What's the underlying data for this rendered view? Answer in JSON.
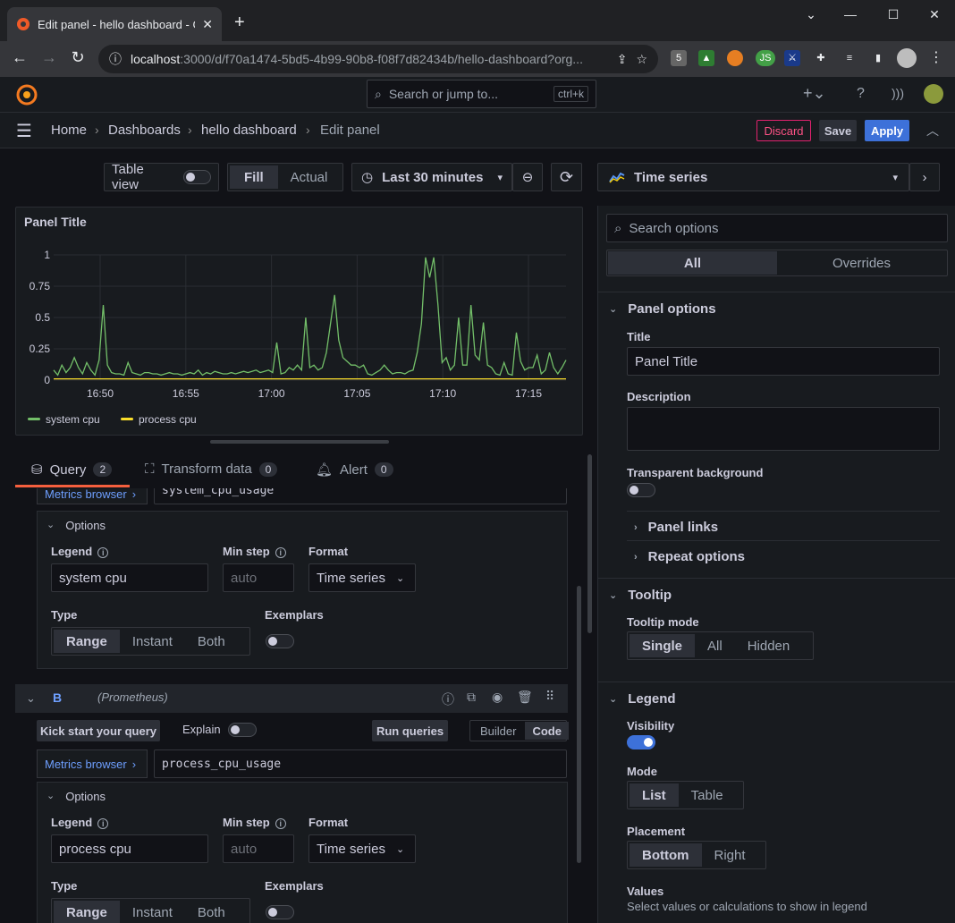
{
  "browser": {
    "tab_title": "Edit panel - hello dashboard - G",
    "url_host": "localhost",
    "url_path": ":3000/d/f70a1474-5bd5-4b99-90b8-f08f7d82434b/hello-dashboard?org..."
  },
  "topbar": {
    "search_placeholder": "Search or jump to...",
    "search_shortcut": "ctrl+k"
  },
  "breadcrumb": {
    "home": "Home",
    "dashboards": "Dashboards",
    "dashboard": "hello dashboard",
    "current": "Edit panel"
  },
  "actions": {
    "discard": "Discard",
    "save": "Save",
    "apply": "Apply"
  },
  "toolbar": {
    "table_view": "Table view",
    "fill": "Fill",
    "actual": "Actual",
    "time_range": "Last 30 minutes"
  },
  "panel": {
    "title": "Panel Title"
  },
  "chart_data": {
    "type": "line",
    "y_ticks": [
      "1",
      "0.75",
      "0.5",
      "0.25",
      "0"
    ],
    "ylim": [
      0,
      1
    ],
    "x_ticks": [
      "16:50",
      "16:55",
      "17:00",
      "17:05",
      "17:10",
      "17:15"
    ],
    "legend_placement": "bottom",
    "series": [
      {
        "name": "system cpu",
        "color": "#73bf69",
        "values": [
          0.08,
          0.04,
          0.12,
          0.06,
          0.1,
          0.18,
          0.1,
          0.05,
          0.14,
          0.08,
          0.04,
          0.16,
          0.6,
          0.12,
          0.06,
          0.05,
          0.05,
          0.04,
          0.14,
          0.06,
          0.05,
          0.04,
          0.06,
          0.06,
          0.05,
          0.05,
          0.04,
          0.05,
          0.06,
          0.05,
          0.05,
          0.04,
          0.05,
          0.06,
          0.05,
          0.08,
          0.04,
          0.06,
          0.05,
          0.07,
          0.06,
          0.05,
          0.05,
          0.06,
          0.05,
          0.06,
          0.07,
          0.06,
          0.07,
          0.08,
          0.06,
          0.07,
          0.08,
          0.06,
          0.3,
          0.05,
          0.06,
          0.1,
          0.08,
          0.12,
          0.08,
          0.5,
          0.1,
          0.12,
          0.08,
          0.1,
          0.22,
          0.45,
          0.68,
          0.32,
          0.18,
          0.15,
          0.12,
          0.12,
          0.1,
          0.12,
          0.05,
          0.04,
          0.06,
          0.08,
          0.12,
          0.08,
          0.05,
          0.06,
          0.06,
          0.05,
          0.07,
          0.08,
          0.22,
          0.45,
          0.98,
          0.82,
          0.98,
          0.6,
          0.14,
          0.18,
          0.08,
          0.12,
          0.5,
          0.12,
          0.12,
          0.6,
          0.2,
          0.16,
          0.46,
          0.12,
          0.1,
          0.05,
          0.04,
          0.14,
          0.05,
          0.04,
          0.38,
          0.15,
          0.08,
          0.1,
          0.1,
          0.2,
          0.05,
          0.08,
          0.22,
          0.1,
          0.05,
          0.1,
          0.16
        ]
      },
      {
        "name": "process cpu",
        "color": "#fade2a",
        "values": [
          0.01,
          0.01,
          0.01,
          0.01,
          0.01,
          0.01,
          0.01,
          0.01,
          0.01,
          0.01,
          0.01,
          0.01,
          0.01,
          0.01,
          0.01,
          0.01,
          0.01,
          0.01,
          0.01,
          0.01,
          0.01,
          0.01,
          0.01,
          0.01,
          0.01,
          0.01,
          0.01,
          0.01,
          0.01,
          0.01,
          0.01,
          0.01,
          0.01,
          0.01,
          0.01,
          0.01,
          0.01,
          0.01,
          0.01,
          0.01,
          0.01,
          0.01,
          0.01,
          0.01,
          0.01,
          0.01,
          0.01,
          0.01,
          0.01,
          0.01,
          0.01,
          0.01,
          0.01,
          0.01,
          0.01,
          0.01,
          0.01,
          0.01,
          0.01,
          0.01,
          0.01,
          0.01,
          0.01,
          0.01,
          0.01,
          0.01,
          0.01,
          0.01,
          0.01,
          0.01,
          0.01,
          0.01,
          0.01,
          0.01,
          0.01,
          0.01,
          0.01,
          0.01,
          0.01,
          0.01,
          0.01,
          0.01,
          0.01,
          0.01,
          0.01,
          0.01,
          0.01,
          0.01,
          0.01,
          0.01,
          0.01,
          0.01,
          0.01,
          0.01,
          0.01,
          0.01,
          0.01,
          0.01,
          0.01,
          0.01,
          0.01,
          0.01,
          0.01,
          0.01,
          0.01,
          0.01,
          0.01,
          0.01,
          0.01,
          0.01,
          0.01,
          0.01,
          0.01,
          0.01,
          0.01,
          0.01,
          0.01,
          0.01,
          0.01,
          0.01,
          0.01,
          0.01,
          0.01,
          0.01,
          0.01
        ]
      }
    ]
  },
  "query_tabs": {
    "query": "Query",
    "query_count": "2",
    "transform": "Transform data",
    "transform_count": "0",
    "alert": "Alert",
    "alert_count": "0"
  },
  "queryA": {
    "metrics_browser": "Metrics browser",
    "expr": "system_cpu_usage",
    "options": "Options",
    "legend_label": "Legend",
    "legend_value": "system cpu",
    "minstep_label": "Min step",
    "minstep_placeholder": "auto",
    "format_label": "Format",
    "format_value": "Time series",
    "type_label": "Type",
    "type_range": "Range",
    "type_instant": "Instant",
    "type_both": "Both",
    "exemplars_label": "Exemplars"
  },
  "queryB": {
    "ref": "B",
    "datasource": "(Prometheus)",
    "kick_start": "Kick start your query",
    "explain": "Explain",
    "run": "Run queries",
    "builder": "Builder",
    "code": "Code",
    "metrics_browser": "Metrics browser",
    "expr": "process_cpu_usage",
    "options": "Options",
    "legend_label": "Legend",
    "legend_value": "process cpu",
    "minstep_label": "Min step",
    "minstep_placeholder": "auto",
    "format_label": "Format",
    "format_value": "Time series",
    "type_label": "Type",
    "type_range": "Range",
    "type_instant": "Instant",
    "type_both": "Both",
    "exemplars_label": "Exemplars"
  },
  "viz": {
    "name": "Time series"
  },
  "options": {
    "search_placeholder": "Search options",
    "all": "All",
    "overrides": "Overrides",
    "panel_options": "Panel options",
    "title_label": "Title",
    "title_value": "Panel Title",
    "description_label": "Description",
    "transparent_label": "Transparent background",
    "panel_links": "Panel links",
    "repeat_options": "Repeat options",
    "tooltip": "Tooltip",
    "tooltip_mode_label": "Tooltip mode",
    "tooltip_single": "Single",
    "tooltip_all": "All",
    "tooltip_hidden": "Hidden",
    "legend": "Legend",
    "visibility_label": "Visibility",
    "mode_label": "Mode",
    "mode_list": "List",
    "mode_table": "Table",
    "placement_label": "Placement",
    "placement_bottom": "Bottom",
    "placement_right": "Right",
    "values_label": "Values",
    "values_desc": "Select values or calculations to show in legend"
  }
}
